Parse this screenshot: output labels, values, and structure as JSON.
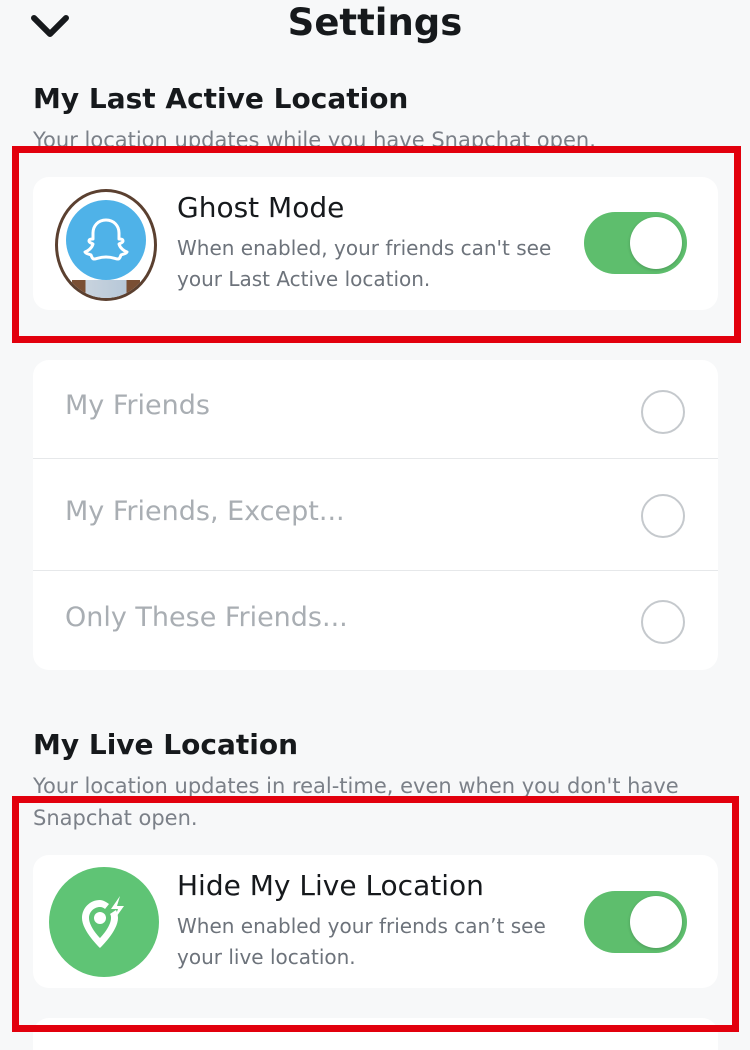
{
  "header": {
    "title": "Settings",
    "back_icon": "chevron-down-icon"
  },
  "last_active": {
    "title": "My Last Active Location",
    "subtitle": "Your location updates while you have Snapchat open.",
    "ghost_mode": {
      "title": "Ghost Mode",
      "description": "When enabled, your friends can't see your Last Active location.",
      "enabled": true,
      "icon": "snapchat-ghost-icon"
    },
    "options": [
      {
        "label": "My Friends",
        "selected": false
      },
      {
        "label": "My Friends, Except...",
        "selected": false
      },
      {
        "label": "Only These Friends...",
        "selected": false
      }
    ]
  },
  "live_location": {
    "title": "My Live Location",
    "subtitle": "Your location updates in real-time, even when you don't have Snapchat open.",
    "hide_live": {
      "title": "Hide My Live Location",
      "description": "When enabled your friends can’t see your live location.",
      "enabled": true,
      "icon": "location-pin-bolt-icon"
    }
  },
  "colors": {
    "toggle_on": "#5ebe6d",
    "highlight": "#e2000d",
    "ghost_bg": "#4fb2e8",
    "live_bg": "#5fc475"
  }
}
